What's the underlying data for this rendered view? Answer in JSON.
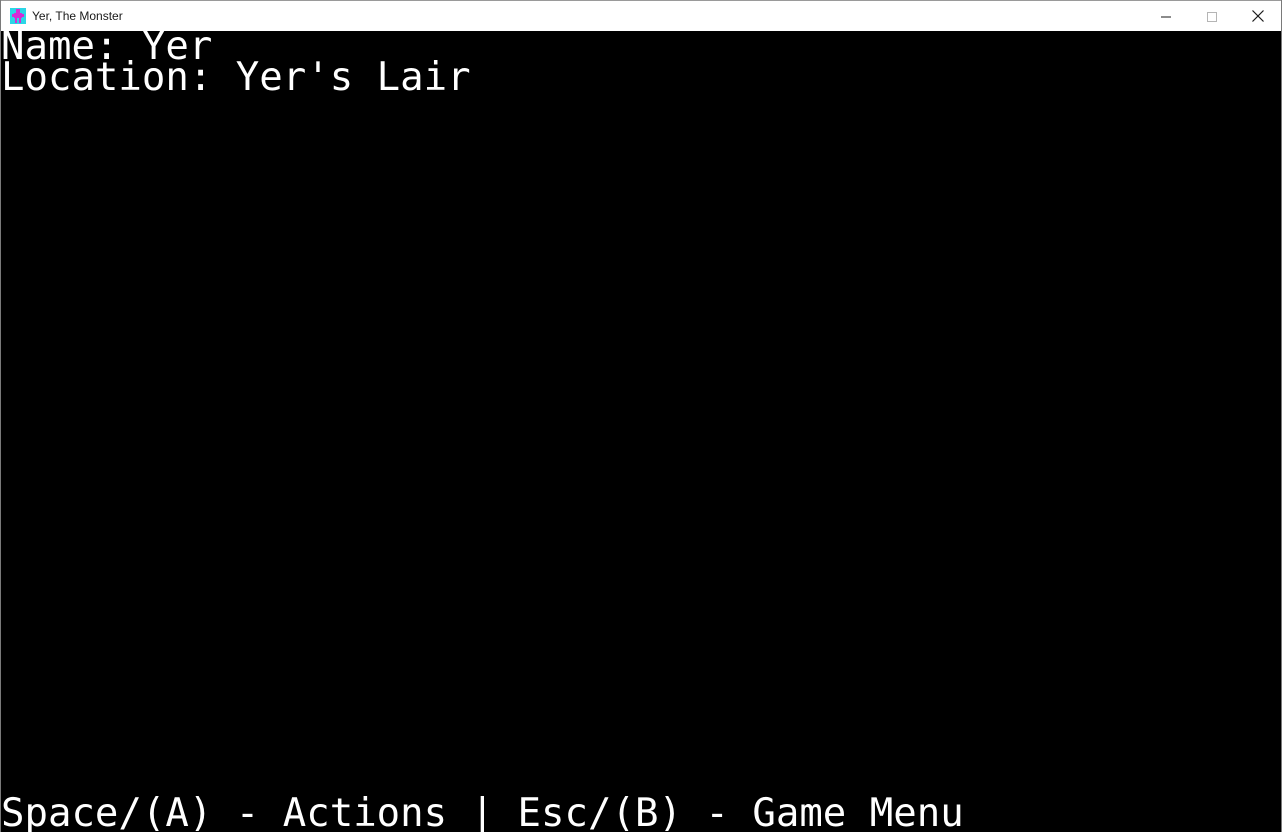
{
  "window": {
    "title": "Yer, The Monster",
    "icon": "monster-app-icon",
    "controls": [
      "minimize-icon",
      "maximize-icon",
      "close-icon"
    ]
  },
  "status": {
    "name_line": "Name: Yer",
    "location_line": "Location: Yer's Lair"
  },
  "footer": {
    "hint": "Space/(A) - Actions | Esc/(B) - Game Menu"
  },
  "colors": {
    "background": "#000000",
    "text": "#ffffff",
    "titlebar": "#ffffff",
    "icon_primary": "#d62bd6",
    "icon_secondary": "#2bd6e6"
  }
}
